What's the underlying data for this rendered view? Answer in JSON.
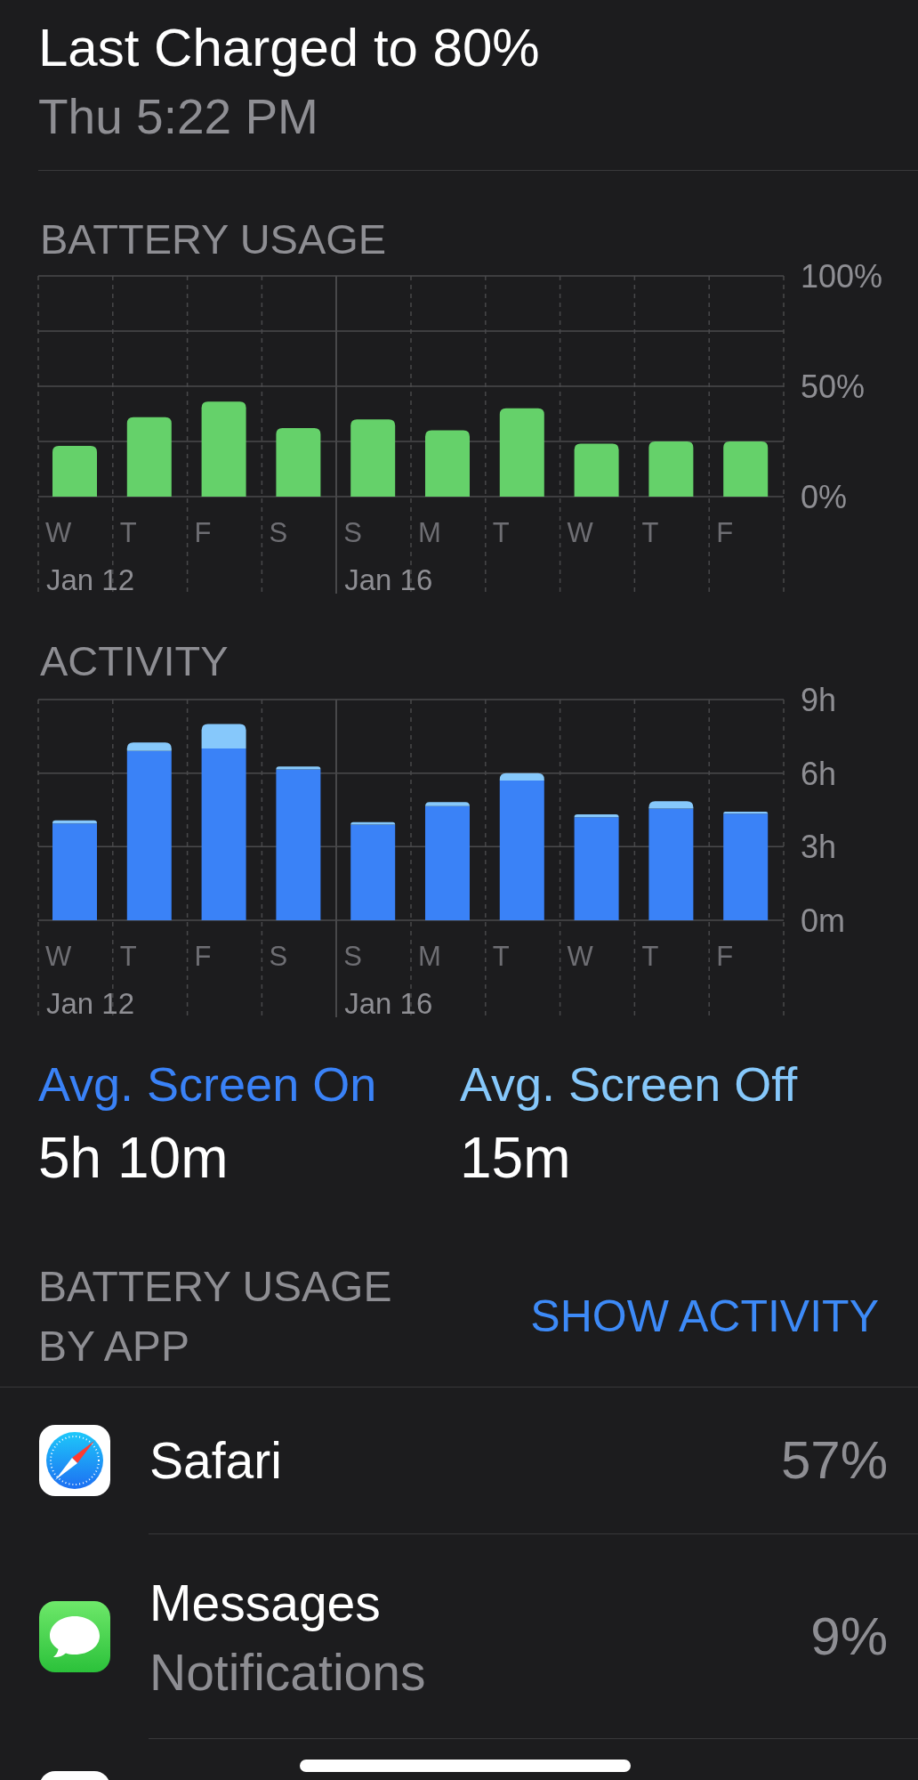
{
  "header": {
    "title": "Last Charged to 80%",
    "subtitle": "Thu 5:22 PM"
  },
  "battery_usage": {
    "heading": "BATTERY USAGE",
    "chart_data": {
      "type": "bar",
      "categories": [
        "W",
        "T",
        "F",
        "S",
        "S",
        "M",
        "T",
        "W",
        "T",
        "F"
      ],
      "series": [
        {
          "color": "#65d16a",
          "values": [
            23,
            36,
            43,
            31,
            35,
            30,
            40,
            24,
            25,
            25
          ]
        }
      ],
      "ylim": [
        0,
        100
      ],
      "yticks": [
        {
          "value": 0,
          "label": "0%"
        },
        {
          "value": 50,
          "label": "50%"
        },
        {
          "value": 100,
          "label": "100%"
        }
      ],
      "annotations": [
        "Jan 12",
        "Jan 16"
      ]
    }
  },
  "activity": {
    "heading": "ACTIVITY",
    "chart_data": {
      "type": "bar",
      "stacked": true,
      "categories": [
        "W",
        "T",
        "F",
        "S",
        "S",
        "M",
        "T",
        "W",
        "T",
        "F"
      ],
      "series": [
        {
          "color": "#3a82f7",
          "values": [
            3.95,
            6.9,
            7.0,
            6.15,
            3.9,
            4.65,
            5.7,
            4.2,
            4.55,
            4.35
          ]
        },
        {
          "color": "#86c8fb",
          "values": [
            0.12,
            0.35,
            1.0,
            0.12,
            0.1,
            0.17,
            0.3,
            0.12,
            0.3,
            0.08
          ]
        }
      ],
      "ylim": [
        0,
        9
      ],
      "yticks": [
        {
          "value": 0,
          "label": "0m"
        },
        {
          "value": 3,
          "label": "3h"
        },
        {
          "value": 6,
          "label": "6h"
        },
        {
          "value": 9,
          "label": "9h"
        }
      ],
      "annotations": [
        "Jan 12",
        "Jan 16"
      ]
    }
  },
  "averages": [
    {
      "label": "Avg. Screen On",
      "value": "5h 10m",
      "color": "#3a82f7"
    },
    {
      "label": "Avg. Screen Off",
      "value": "15m",
      "color": "#86c8fb"
    }
  ],
  "apps_section": {
    "heading": "BATTERY USAGE BY APP",
    "action": "SHOW ACTIVITY"
  },
  "apps": [
    {
      "name": "Safari",
      "percent": "57%"
    },
    {
      "name": "Messages",
      "detail": "Notifications",
      "percent": "9%"
    }
  ]
}
